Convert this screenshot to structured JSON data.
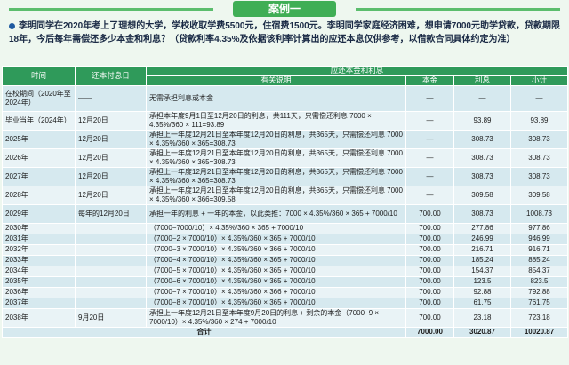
{
  "banner": {
    "title": "案例一"
  },
  "intro": "李明同学在2020年考上了理想的大学，学校收取学费5500元，住宿费1500元。李明同学家庭经济困难，想申请7000元助学贷款，贷款期限18年，今后每年需偿还多少本金和利息？（贷款利率4.35%及依据该利率计算出的应还本息仅供参考，以借款合同具体约定为准）",
  "table": {
    "headers": {
      "time": "时间",
      "date": "还本付息日",
      "group": "应还本金和利息",
      "desc": "有关说明",
      "principal": "本金",
      "interest": "利息",
      "subtotal": "小计"
    },
    "rows": [
      {
        "time": "在校期间（2020年至2024年）",
        "date": "——",
        "desc": "无需承担利息或本金",
        "principal": "—",
        "interest": "—",
        "subtotal": "—",
        "h": "h3"
      },
      {
        "time": "毕业当年（2024年）",
        "date": "12月20日",
        "desc": "承担本年度9月1日至12月20日的利息，共111天，只需偿还利息 7000 × 4.35%/360 × 111=93.89",
        "principal": "—",
        "interest": "93.89",
        "subtotal": "93.89",
        "h": "h2"
      },
      {
        "time": "2025年",
        "date": "12月20日",
        "desc": "承担上一年度12月21日至本年度12月20日的利息，共365天，只需偿还利息 7000 × 4.35%/360 × 365=308.73",
        "principal": "—",
        "interest": "308.73",
        "subtotal": "308.73",
        "h": "h2"
      },
      {
        "time": "2026年",
        "date": "12月20日",
        "desc": "承担上一年度12月21日至本年度12月20日的利息，共365天，只需偿还利息 7000 × 4.35%/360 × 365=308.73",
        "principal": "—",
        "interest": "308.73",
        "subtotal": "308.73",
        "h": "h2"
      },
      {
        "time": "2027年",
        "date": "12月20日",
        "desc": "承担上一年度12月21日至本年度12月20日的利息，共365天，只需偿还利息 7000 × 4.35%/360 × 365=308.73",
        "principal": "—",
        "interest": "308.73",
        "subtotal": "308.73",
        "h": "h2"
      },
      {
        "time": "2028年",
        "date": "12月20日",
        "desc": "承担上一年度12月21日至本年度12月20日的利息，共365天，只需偿还利息 7000 × 4.35%/360 × 366=309.58",
        "principal": "—",
        "interest": "309.58",
        "subtotal": "309.58",
        "h": "h2"
      },
      {
        "time": "2029年",
        "date": "每年的12月20日",
        "desc": "承担一年的利息 + 一年的本金，以此类推：7000 × 4.35%/360 × 365 + 7000/10",
        "principal": "700.00",
        "interest": "308.73",
        "subtotal": "1008.73",
        "h": "h2"
      },
      {
        "time": "2030年",
        "date": "",
        "desc": "（7000−7000/10）× 4.35%/360 × 365 + 7000/10",
        "principal": "700.00",
        "interest": "277.86",
        "subtotal": "977.86",
        "h": "h1"
      },
      {
        "time": "2031年",
        "date": "",
        "desc": "（7000−2 × 7000/10）× 4.35%/360 × 365 + 7000/10",
        "principal": "700.00",
        "interest": "246.99",
        "subtotal": "946.99",
        "h": "h1"
      },
      {
        "time": "2032年",
        "date": "",
        "desc": "（7000−3 × 7000/10）× 4.35%/360 × 366 + 7000/10",
        "principal": "700.00",
        "interest": "216.71",
        "subtotal": "916.71",
        "h": "h1"
      },
      {
        "time": "2033年",
        "date": "",
        "desc": "（7000−4 × 7000/10）× 4.35%/360 × 365 + 7000/10",
        "principal": "700.00",
        "interest": "185.24",
        "subtotal": "885.24",
        "h": "h1"
      },
      {
        "time": "2034年",
        "date": "",
        "desc": "（7000−5 × 7000/10）× 4.35%/360 × 365 + 7000/10",
        "principal": "700.00",
        "interest": "154.37",
        "subtotal": "854.37",
        "h": "h1"
      },
      {
        "time": "2035年",
        "date": "",
        "desc": "（7000−6 × 7000/10）× 4.35%/360 × 365 + 7000/10",
        "principal": "700.00",
        "interest": "123.5",
        "subtotal": "823.5",
        "h": "h1"
      },
      {
        "time": "2036年",
        "date": "",
        "desc": "（7000−7 × 7000/10）× 4.35%/360 × 366 + 7000/10",
        "principal": "700.00",
        "interest": "92.88",
        "subtotal": "792.88",
        "h": "h1"
      },
      {
        "time": "2037年",
        "date": "",
        "desc": "（7000−8 × 7000/10）× 4.35%/360 × 365 + 7000/10",
        "principal": "700.00",
        "interest": "61.75",
        "subtotal": "761.75",
        "h": "h1"
      },
      {
        "time": "2038年",
        "date": "9月20日",
        "desc": "承担上一年度12月21日至本年度9月20日的利息 + 剩余的本金（7000−9 × 7000/10）× 4.35%/360 × 274 + 7000/10",
        "principal": "700.00",
        "interest": "23.18",
        "subtotal": "723.18",
        "h": "h2"
      }
    ],
    "total": {
      "label": "合计",
      "principal": "7000.00",
      "interest": "3020.87",
      "subtotal": "10020.87"
    }
  }
}
